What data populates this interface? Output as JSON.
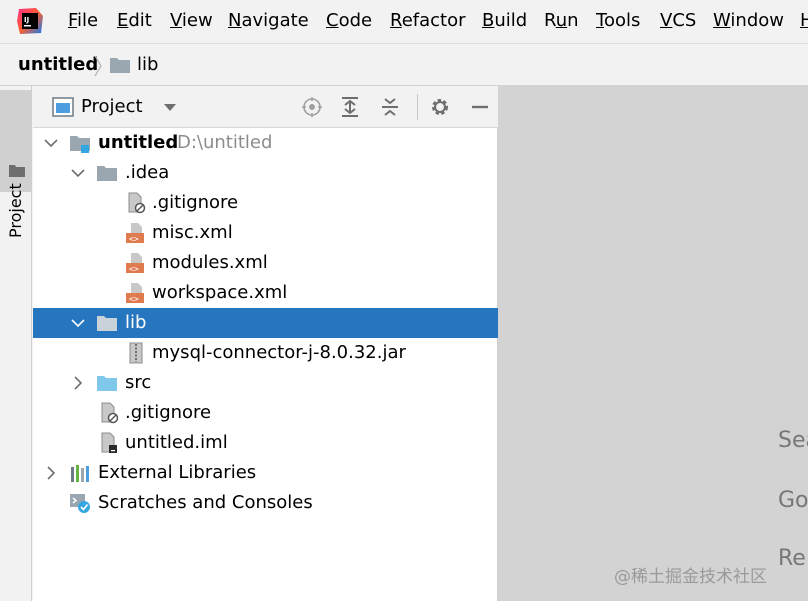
{
  "menu": [
    {
      "mnemonic": "F",
      "rest": "ile"
    },
    {
      "mnemonic": "E",
      "rest": "dit"
    },
    {
      "mnemonic": "V",
      "rest": "iew"
    },
    {
      "mnemonic": "N",
      "rest": "avigate"
    },
    {
      "mnemonic": "C",
      "rest": "ode"
    },
    {
      "mnemonic": "R",
      "rest": "efactor"
    },
    {
      "mnemonic": "B",
      "rest": "uild"
    },
    {
      "pre": "R",
      "mnemonic": "u",
      "rest": "n"
    },
    {
      "mnemonic": "T",
      "rest": "ools"
    },
    {
      "mnemonic": "V",
      "rest": "CS"
    },
    {
      "mnemonic": "W",
      "rest": "indow"
    },
    {
      "mnemonic": "H",
      "rest": ""
    }
  ],
  "breadcrumb": {
    "project": "untitled",
    "folder": "lib"
  },
  "tool_strip": {
    "project_tab": "Project"
  },
  "panel": {
    "title": "Project"
  },
  "tree": [
    {
      "label": "untitled",
      "hint": "D:\\untitled",
      "bold": true
    },
    {
      "label": ".idea"
    },
    {
      "label": ".gitignore"
    },
    {
      "label": "misc.xml"
    },
    {
      "label": "modules.xml"
    },
    {
      "label": "workspace.xml"
    },
    {
      "label": "lib"
    },
    {
      "label": "mysql-connector-j-8.0.32.jar"
    },
    {
      "label": "src"
    },
    {
      "label": ".gitignore"
    },
    {
      "label": "untitled.iml"
    },
    {
      "label": "External Libraries"
    },
    {
      "label": "Scratches and Consoles"
    }
  ],
  "editor_hints": [
    "Sea",
    "Go",
    "Re"
  ],
  "watermark": "@稀土掘金技术社区",
  "colors": {
    "selection": "#2675bf",
    "folder": "#9aa7b0",
    "source_folder": "#7fc8eb",
    "xml": "#e07a4f",
    "editor_bg": "#d3d3d3"
  }
}
